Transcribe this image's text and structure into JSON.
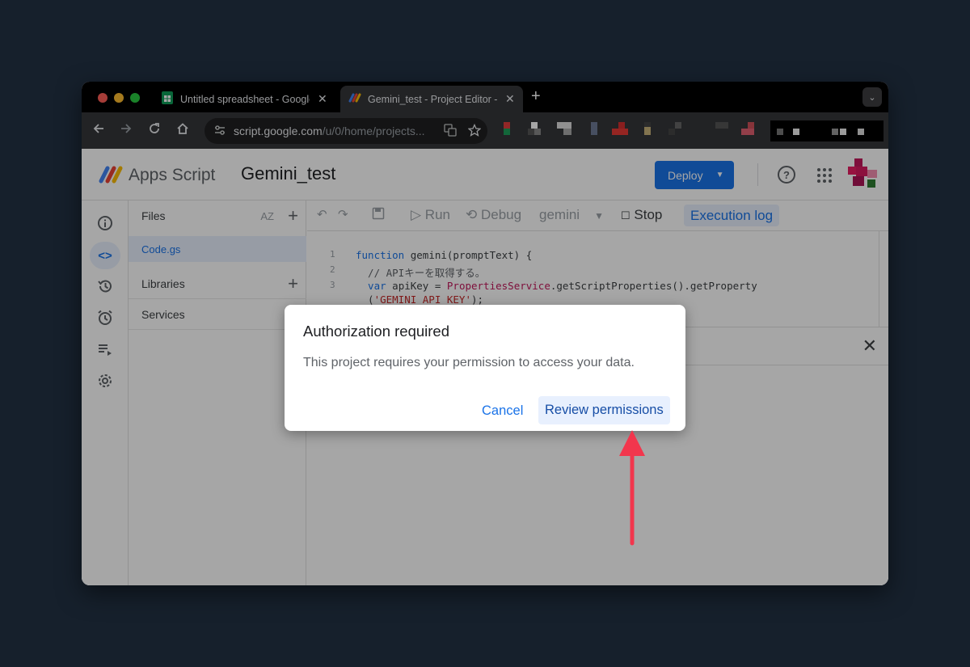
{
  "browser": {
    "tabs": [
      {
        "title": "Untitled spreadsheet - Google Sheets",
        "icon": "google-sheets-icon",
        "close": "✕"
      },
      {
        "title": "Gemini_test - Project Editor - Apps Script",
        "icon": "apps-script-icon",
        "close": "✕"
      }
    ],
    "new_tab": "+",
    "tab_menu": "⌄",
    "url_host": "script.google.com",
    "url_path": "/u/0/home/projects..."
  },
  "app": {
    "brand": "Apps Script",
    "project_name": "Gemini_test",
    "deploy_label": "Deploy",
    "help_glyph": "?",
    "files_label": "Files",
    "sort_glyph": "AZ",
    "file_name": "Code.gs",
    "libraries_label": "Libraries",
    "services_label": "Services",
    "add_glyph": "+",
    "run_label": "Run",
    "debug_label": "Debug",
    "function_select": "gemini",
    "stop_label": "Stop",
    "execution_log_label": "Execution log",
    "close_glyph": "✕",
    "code": {
      "line_numbers": [
        "1",
        "2",
        "3"
      ],
      "line1": {
        "kw": "function",
        "rest": " gemini(promptText) {"
      },
      "line2": "  // APIキーを取得する。",
      "line3": {
        "kw": "  var",
        "mid": " apiKey = ",
        "svc": "PropertiesService",
        "rest": ".getScriptProperties().getProperty"
      },
      "line4": {
        "open": "  (",
        "str": "'GEMINI_API_KEY'",
        "rest": ");"
      }
    }
  },
  "dialog": {
    "title": "Authorization required",
    "body": "This project requires your permission to access your data.",
    "cancel_label": "Cancel",
    "review_label": "Review permissions"
  },
  "colors": {
    "accent": "#1a73e8",
    "annotation_arrow": "#f2364d"
  }
}
